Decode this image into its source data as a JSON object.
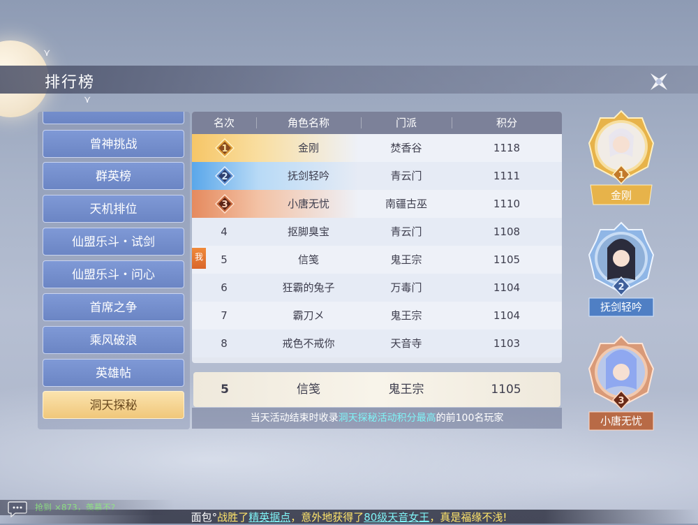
{
  "header": {
    "title": "排行榜"
  },
  "menu": {
    "items": [
      {
        "label": "曾神挑战"
      },
      {
        "label": "群英榜"
      },
      {
        "label": "天机排位"
      },
      {
        "label": "仙盟乐斗・试剑"
      },
      {
        "label": "仙盟乐斗・问心"
      },
      {
        "label": "首席之争"
      },
      {
        "label": "乘风破浪"
      },
      {
        "label": "英雄帖"
      },
      {
        "label": "洞天探秘",
        "active": true
      }
    ]
  },
  "table": {
    "headers": [
      "名次",
      "角色名称",
      "门派",
      "积分"
    ],
    "rows": [
      {
        "rank": "1",
        "name": "金刚",
        "sect": "焚香谷",
        "score": "1118"
      },
      {
        "rank": "2",
        "name": "抚剑轻吟",
        "sect": "青云门",
        "score": "1111"
      },
      {
        "rank": "3",
        "name": "小唐无忧",
        "sect": "南疆古巫",
        "score": "1110"
      },
      {
        "rank": "4",
        "name": "抠脚臭宝",
        "sect": "青云门",
        "score": "1108"
      },
      {
        "rank": "5",
        "name": "信笺",
        "sect": "鬼王宗",
        "score": "1105"
      },
      {
        "rank": "6",
        "name": "狂霸的兔子",
        "sect": "万毒门",
        "score": "1104"
      },
      {
        "rank": "7",
        "name": "霸刀メ",
        "sect": "鬼王宗",
        "score": "1104"
      },
      {
        "rank": "8",
        "name": "戒色不戒你",
        "sect": "天音寺",
        "score": "1103"
      }
    ],
    "me_tag": "我"
  },
  "my_rank": {
    "rank": "5",
    "name": "信笺",
    "sect": "鬼王宗",
    "score": "1105"
  },
  "notice": {
    "prefix": "当天活动结束时收录",
    "highlight": "洞天探秘活动积分最高",
    "suffix": "的前100名玩家"
  },
  "podium": [
    {
      "rank": "1",
      "name": "金刚"
    },
    {
      "rank": "2",
      "name": "抚剑轻吟"
    },
    {
      "rank": "3",
      "name": "小唐无忧"
    }
  ],
  "chat": {
    "text": "抢到 ×873，羡慕不?"
  },
  "broadcast": {
    "p1": "面包°",
    "p2": "战胜了",
    "p3": "精英据点",
    "p4": "，意外地获得了",
    "p5": "80级天音女王",
    "p6": "，真是福缘不浅!"
  },
  "colors": {
    "gold": "#f1b23c",
    "silver_blue": "#4a8fd8",
    "bronze": "#d9754a",
    "highlight_cyan": "#7ff3f6",
    "active_menu": "#f0c77a"
  }
}
